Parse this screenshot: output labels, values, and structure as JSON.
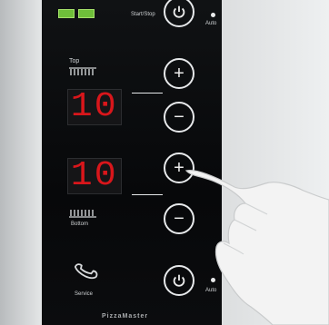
{
  "top_strip": {
    "label": "Start/Stop"
  },
  "top_section": {
    "label": "Top",
    "display_value": "10"
  },
  "bottom_section": {
    "label": "Bottom",
    "display_value": "10"
  },
  "buttons": {
    "plus": "+",
    "minus": "−"
  },
  "auto_label": "Auto",
  "service": {
    "label": "Service"
  },
  "brand": "PizzaMaster"
}
